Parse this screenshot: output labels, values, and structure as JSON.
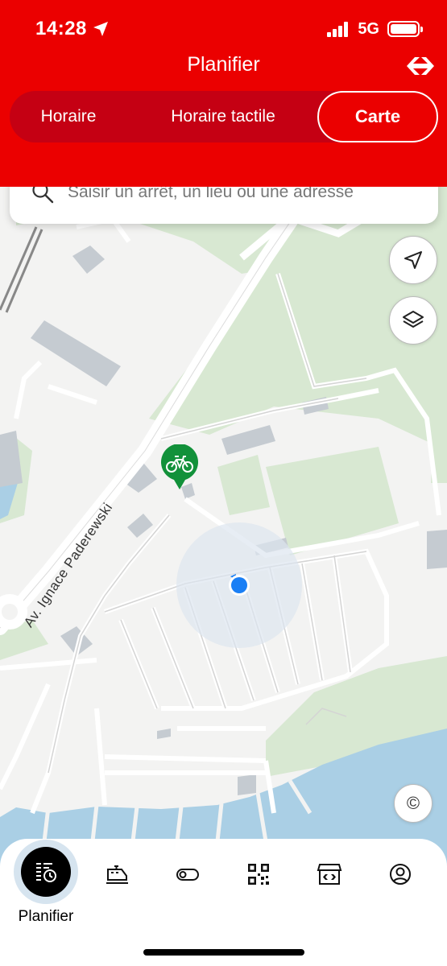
{
  "status_bar": {
    "time": "14:28",
    "network": "5G",
    "icons": [
      "location-arrow-icon",
      "signal-icon",
      "battery-icon"
    ]
  },
  "header": {
    "title": "Planifier",
    "logo": "sbb-logo-icon"
  },
  "segmented": {
    "tabs": [
      "Horaire",
      "Horaire tactile",
      "Carte"
    ],
    "active": "Carte"
  },
  "search": {
    "placeholder": "Saisir un arrêt, un lieu ou une adresse"
  },
  "map": {
    "street_label": "Av. Ignace Paderewski",
    "buttons": [
      "location-arrow-icon",
      "layers-icon",
      "copyright-icon"
    ],
    "copyright_symbol": "©",
    "markers": [
      "bike-station-marker",
      "current-location-dot"
    ]
  },
  "tabbar": {
    "active_label": "Planifier",
    "tabs": [
      "planner-icon",
      "train-icon",
      "toggle-icon",
      "qr-code-icon",
      "shop-icon",
      "profile-icon"
    ]
  },
  "colors": {
    "brand_red": "#eb0000",
    "segment_bg": "#c50013",
    "park_green": "#d8e8d2",
    "water_blue": "#aacfe5",
    "bike_green": "#12913a",
    "location_blue": "#1a7ff5"
  }
}
